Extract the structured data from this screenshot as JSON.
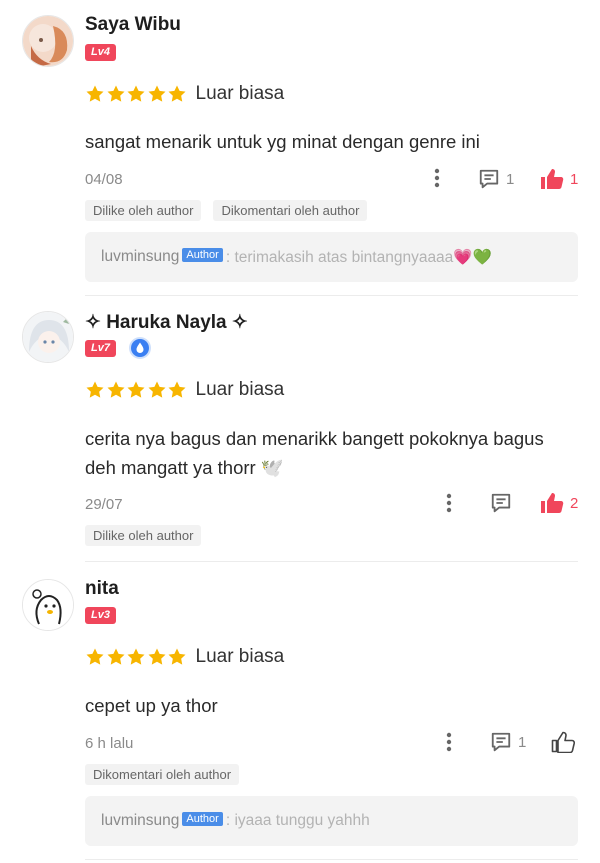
{
  "reviews": [
    {
      "user": "Saya Wibu",
      "level": "Lv4",
      "rating_label": "Luar biasa",
      "text": "sangat menarik untuk yg minat dengan genre ini",
      "date": "04/08",
      "comment_count": "1",
      "like_count": "1",
      "tags": [
        "Dilike oleh author",
        "Dikomentari oleh author"
      ],
      "reply": {
        "name": "luvminsung",
        "badge": "Author",
        "text": ": terimakasih atas bintangnyaaaa💗💚"
      }
    },
    {
      "user": "✧ Haruka Nayla ✧",
      "level": "Lv7",
      "rating_label": "Luar biasa",
      "text": "cerita nya bagus dan menarikk bangett pokoknya bagus deh mangatt ya thorr 🕊️",
      "date": "29/07",
      "comment_count": "",
      "like_count": "2",
      "tags": [
        "Dilike oleh author"
      ]
    },
    {
      "user": "nita",
      "level": "Lv3",
      "rating_label": "Luar biasa",
      "text": "cepet up ya thor",
      "date": "6 h lalu",
      "comment_count": "1",
      "like_count": "",
      "tags": [
        "Dikomentari oleh author"
      ],
      "reply": {
        "name": "luvminsung",
        "badge": "Author",
        "text": ": iyaaa tunggu yahhh"
      }
    }
  ],
  "colors": {
    "accent": "#f0465b",
    "star": "#f7b500",
    "badge": "#3a7ff2"
  }
}
